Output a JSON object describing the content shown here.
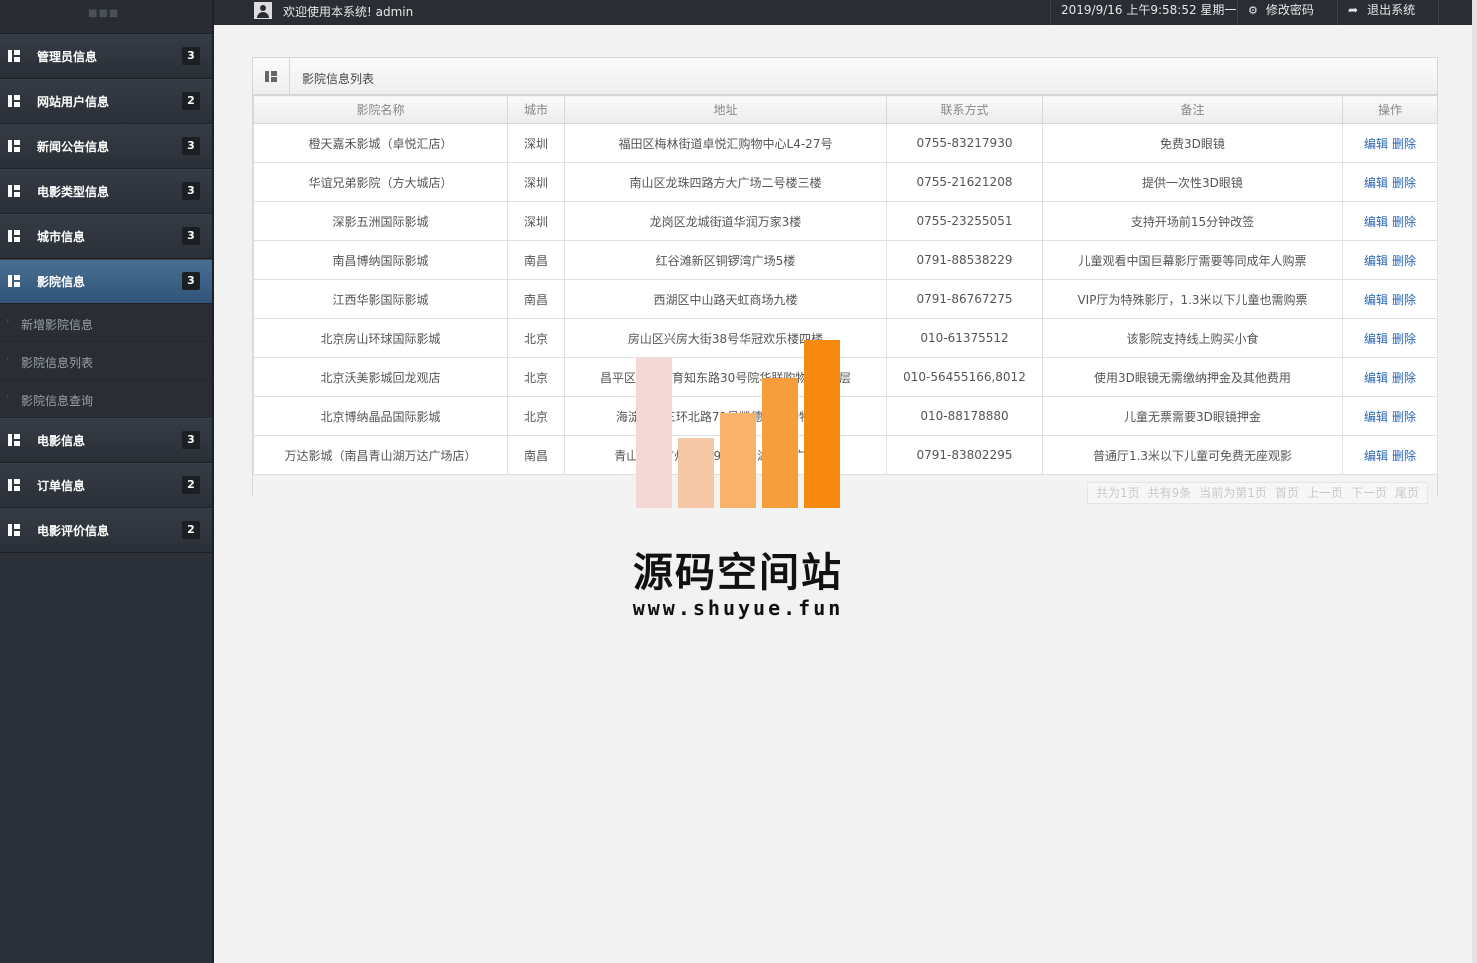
{
  "topbar": {
    "welcome": "欢迎使用本系统! admin",
    "datetime": "2019/9/16 上午9:58:52 星期一",
    "change_password": "修改密码",
    "logout": "退出系统"
  },
  "sidebar": {
    "items": [
      {
        "label": "管理员信息",
        "badge": "3"
      },
      {
        "label": "网站用户信息",
        "badge": "2"
      },
      {
        "label": "新闻公告信息",
        "badge": "3"
      },
      {
        "label": "电影类型信息",
        "badge": "3"
      },
      {
        "label": "城市信息",
        "badge": "3"
      },
      {
        "label": "影院信息",
        "badge": "3"
      },
      {
        "label": "电影信息",
        "badge": "3"
      },
      {
        "label": "订单信息",
        "badge": "2"
      },
      {
        "label": "电影评价信息",
        "badge": "2"
      }
    ],
    "subitems": [
      "新增影院信息",
      "影院信息列表",
      "影院信息查询"
    ]
  },
  "panel": {
    "title": "影院信息列表",
    "headers": [
      "影院名称",
      "城市",
      "地址",
      "联系方式",
      "备注",
      "操作"
    ],
    "edit_label": "编辑",
    "delete_label": "删除",
    "rows": [
      [
        "橙天嘉禾影城（卓悦汇店）",
        "深圳",
        "福田区梅林街道卓悦汇购物中心L4-27号",
        "0755-83217930",
        "免费3D眼镜"
      ],
      [
        "华谊兄弟影院（方大城店）",
        "深圳",
        "南山区龙珠四路方大广场二号楼三楼",
        "0755-21621208",
        "提供一次性3D眼镜"
      ],
      [
        "深影五洲国际影城",
        "深圳",
        "龙岗区龙城街道华润万家3楼",
        "0755-23255051",
        "支持开场前15分钟改签"
      ],
      [
        "南昌博纳国际影城",
        "南昌",
        "红谷滩新区铜锣湾广场5楼",
        "0791-88538229",
        "儿童观看中国巨幕影厅需要等同成年人购票"
      ],
      [
        "江西华影国际影城",
        "南昌",
        "西湖区中山路天虹商场九楼",
        "0791-86767275",
        "VIP厅为特殊影厅，1.3米以下儿童也需购票"
      ],
      [
        "北京房山环球国际影城",
        "北京",
        "房山区兴房大街38号华冠欢乐楼四楼",
        "010-61375512",
        "该影院支持线上购买小食"
      ],
      [
        "北京沃美影城回龙观店",
        "北京",
        "昌平区回龙观育知东路30号院华联购物中心4层",
        "010-56455166,8012",
        "使用3D眼镜无需缴纳押金及其他费用"
      ],
      [
        "北京博纳晶品国际影城",
        "北京",
        "海淀区西三环北路71号凯德晶品购物中心",
        "010-88178880",
        "儿童无票需要3D眼镜押金"
      ],
      [
        "万达影城（南昌青山湖万达广场店）",
        "南昌",
        "青山湖区广州路999号青山湖万达广场3楼",
        "0791-83802295",
        "普通厅1.3米以下儿童可免费无座观影"
      ]
    ],
    "pager": [
      "共为1页",
      "共有9条",
      "当前为第1页",
      "首页",
      "上一页",
      "下一页",
      "尾页"
    ]
  },
  "watermark": {
    "title": "源码空间站",
    "url": "www.shuyue.fun"
  },
  "colors": {
    "sidebar_bg": "#2c3139",
    "active_item": "#3f6386",
    "link": "#2a66b5",
    "watermark_orange": "#f7890f"
  }
}
